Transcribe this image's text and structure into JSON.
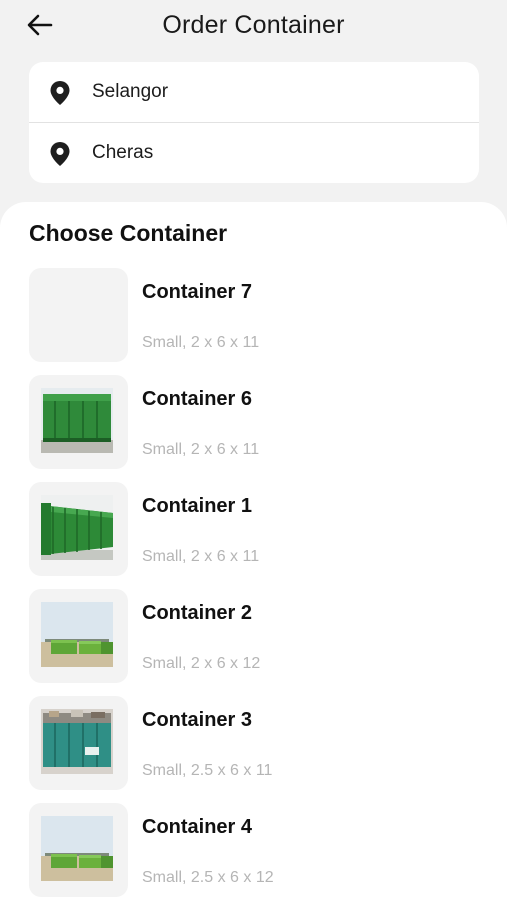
{
  "header": {
    "title": "Order Container",
    "back_icon": "arrow-left-icon"
  },
  "locations": [
    {
      "label": "Selangor",
      "icon": "location-pin-icon"
    },
    {
      "label": "Cheras",
      "icon": "location-pin-icon"
    }
  ],
  "section": {
    "title": "Choose Container"
  },
  "containers": [
    {
      "name": "Container 7",
      "spec": "Small, 2 x 6 x 11",
      "image": "empty"
    },
    {
      "name": "Container 6",
      "spec": "Small, 2 x 6 x 11",
      "image": "green-roll-off-bin"
    },
    {
      "name": "Container 1",
      "spec": "Small, 2 x 6 x 11",
      "image": "green-roll-off-bin-side"
    },
    {
      "name": "Container 2",
      "spec": "Small, 2 x 6 x 12",
      "image": "green-bins-outdoor"
    },
    {
      "name": "Container 3",
      "spec": "Small, 2.5 x 6 x 11",
      "image": "teal-bin-loaded"
    },
    {
      "name": "Container 4",
      "spec": "Small, 2.5 x 6 x 12",
      "image": "green-bins-outdoor"
    }
  ],
  "colors": {
    "background": "#f2f2f2",
    "card": "#ffffff",
    "muted_text": "#b5b5b5",
    "pin": "#1e1e1e"
  }
}
